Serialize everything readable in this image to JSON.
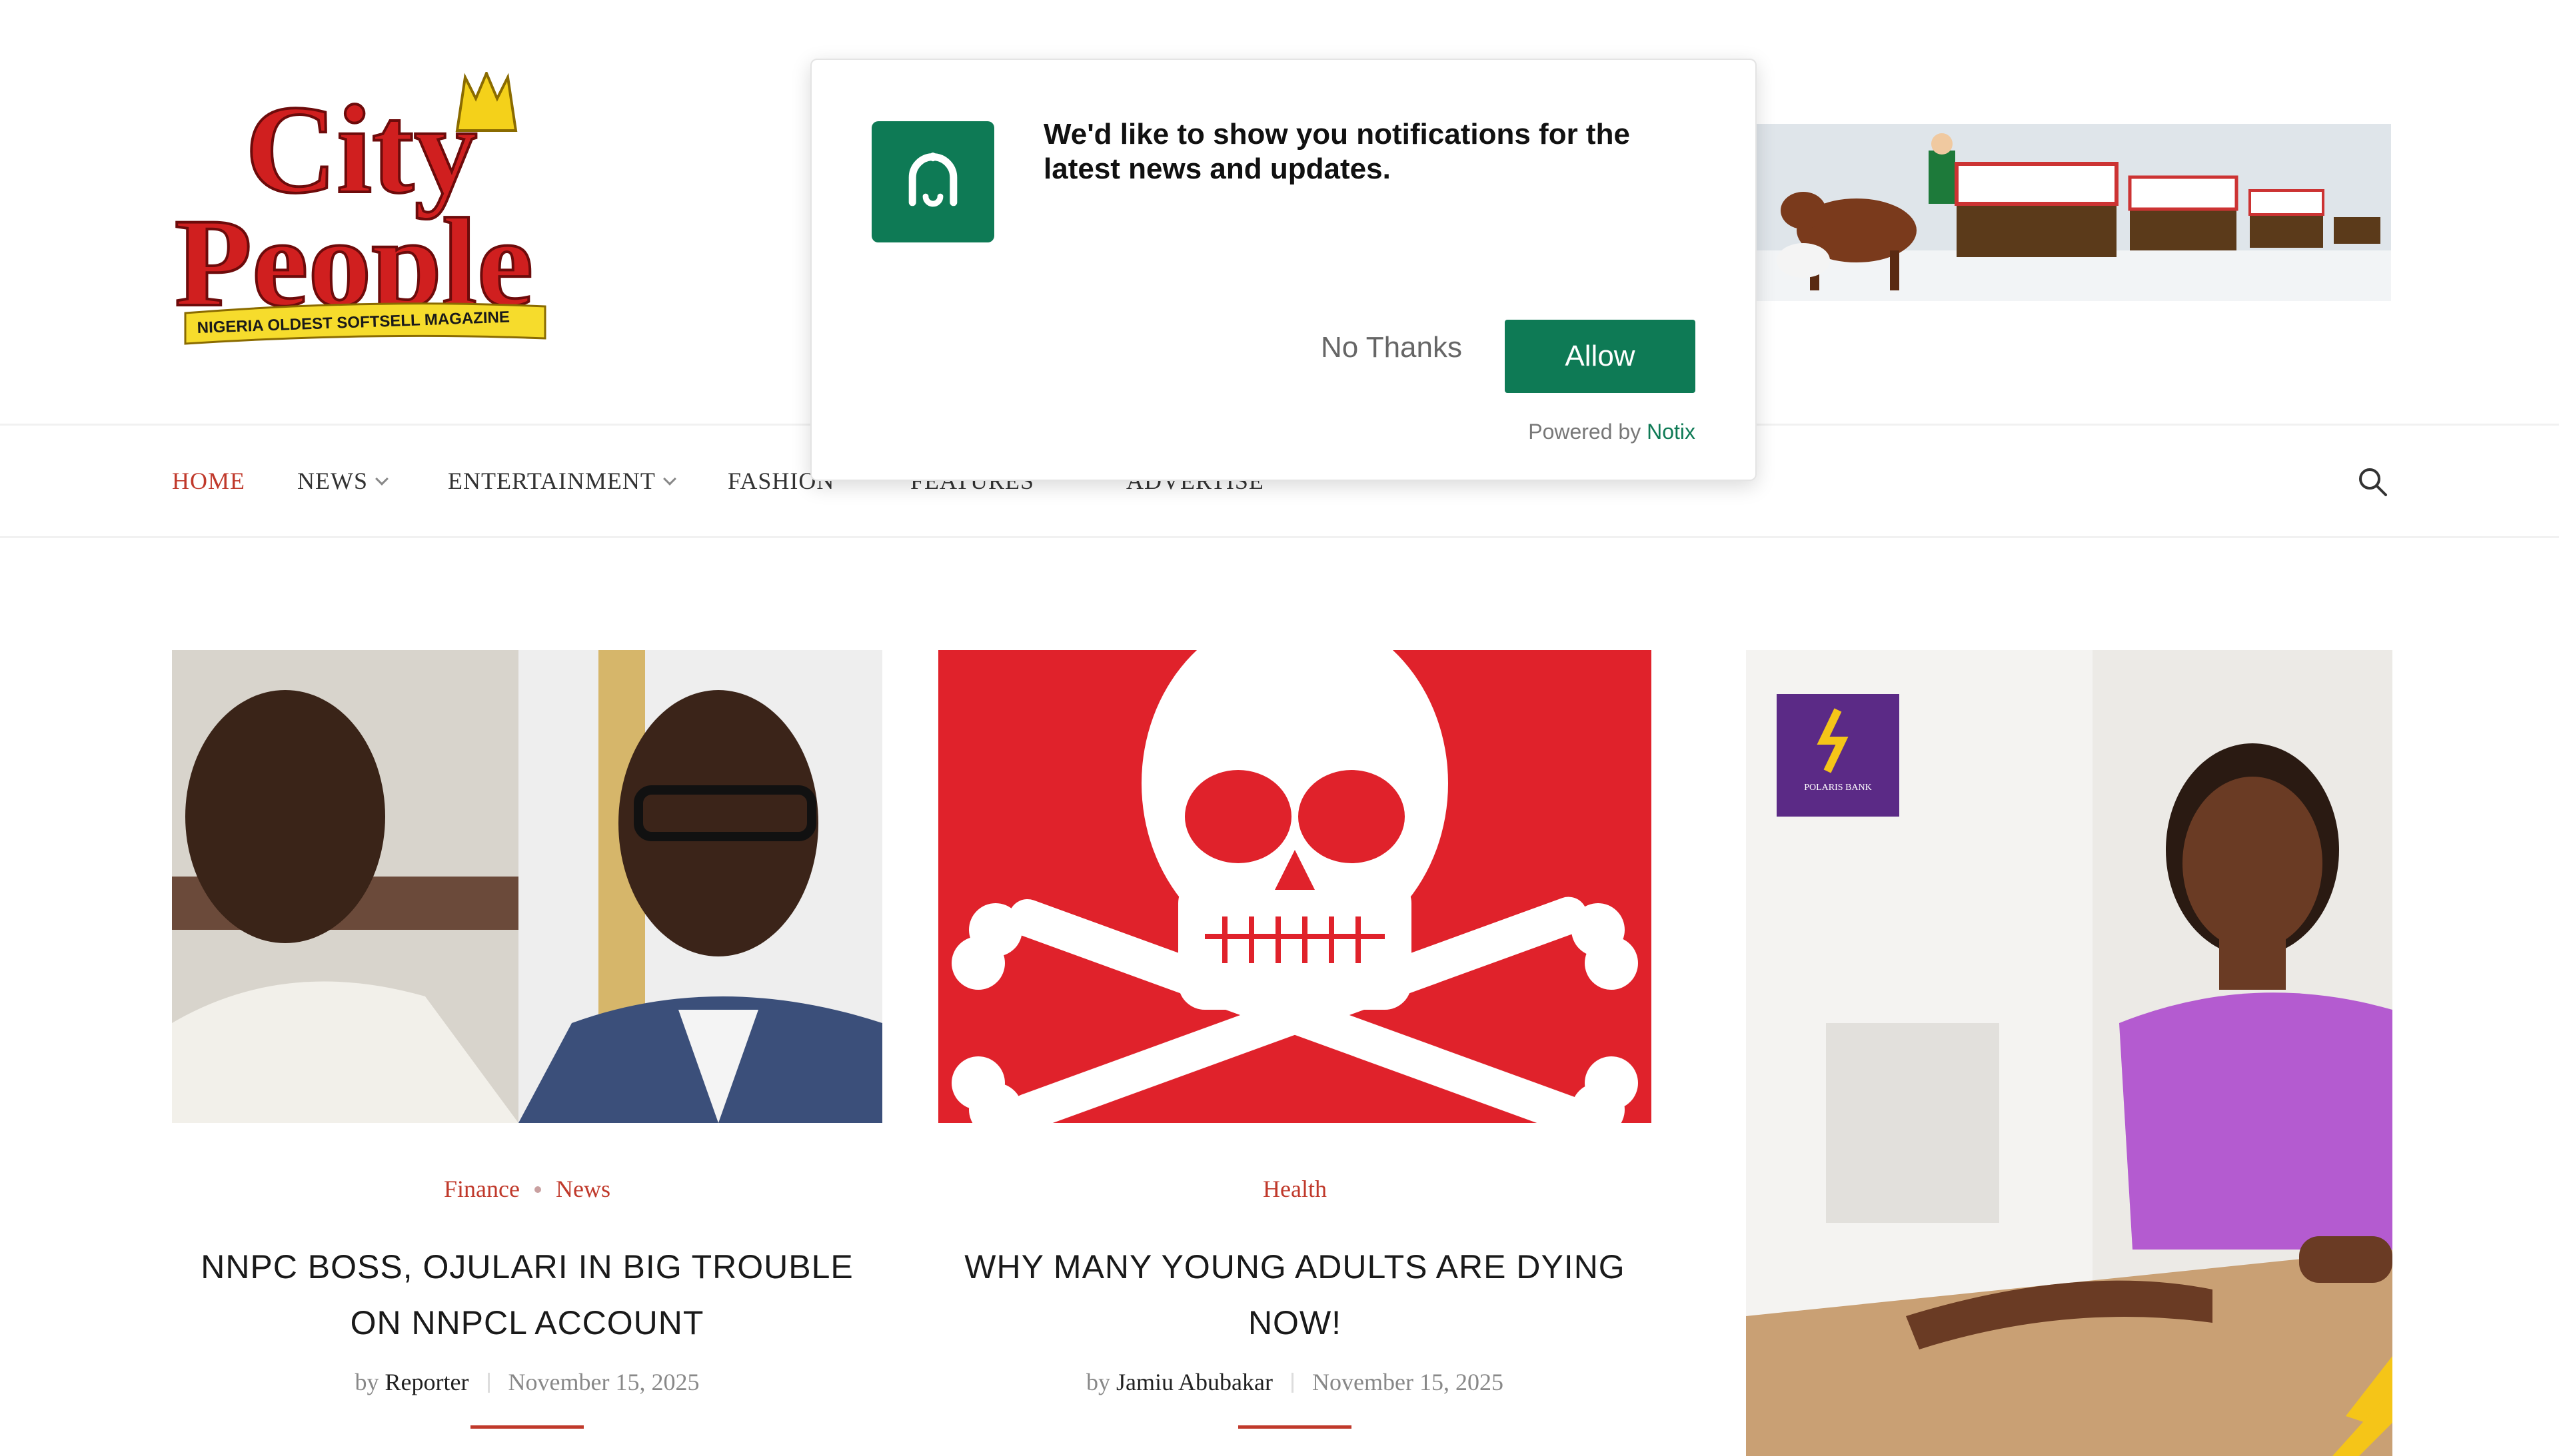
{
  "logo": {
    "line1": "City",
    "line2": "People",
    "tagline": "NIGERIA OLDEST SOFTSELL MAGAZINE"
  },
  "nav": {
    "items": [
      {
        "label": "HOME",
        "active": true,
        "dropdown": false
      },
      {
        "label": "NEWS",
        "active": false,
        "dropdown": true
      },
      {
        "label": "ENTERTAINMENT",
        "active": false,
        "dropdown": true
      },
      {
        "label": "FASHION",
        "active": false,
        "dropdown": false
      },
      {
        "label": "FEATURES",
        "active": false,
        "dropdown": false
      },
      {
        "label": "ADVERTISE",
        "active": false,
        "dropdown": false
      }
    ]
  },
  "popup": {
    "message": "We'd like to show you notifications for the latest news and updates.",
    "no_label": "No Thanks",
    "allow_label": "Allow",
    "powered_prefix": "Powered by",
    "powered_brand": "Notix",
    "accent": "#0e7a55"
  },
  "articles": [
    {
      "categories": [
        "Finance",
        "News"
      ],
      "title": "NNPC BOSS, OJULARI IN BIG TROUBLE ON NNPCL ACCOUNT",
      "by": "by",
      "author": "Reporter",
      "date": "November 15, 2025"
    },
    {
      "categories": [
        "Health"
      ],
      "title": "WHY MANY YOUNG ADULTS ARE DYING NOW!",
      "by": "by",
      "author": "Jamiu Abubakar",
      "date": "November 15, 2025"
    }
  ],
  "side_ad": {
    "brand": "POLARIS BANK"
  },
  "colors": {
    "accent_red": "#c0392b",
    "green": "#0e7a55",
    "skull_bg": "#e0222b"
  },
  "icons": {
    "search": "search-icon",
    "bell": "bell-icon"
  }
}
